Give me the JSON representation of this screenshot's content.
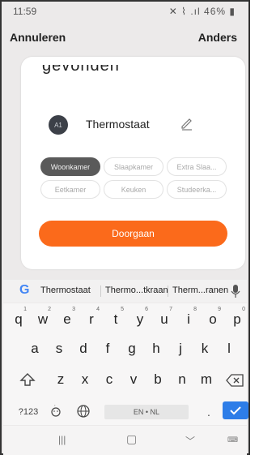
{
  "status_bar": {
    "time": "11:59",
    "indicators": "46%"
  },
  "nav": {
    "cancel_label": "Annuleren",
    "other_label": "Anders"
  },
  "card": {
    "heading_fragment": "gevonden",
    "device": {
      "avatar_text": "A1",
      "name": "Thermostaat"
    },
    "rooms": [
      {
        "label": "Woonkamer",
        "selected": true
      },
      {
        "label": "Slaapkamer",
        "selected": false
      },
      {
        "label": "Extra Slaa...",
        "selected": false
      },
      {
        "label": "Eetkamer",
        "selected": false
      },
      {
        "label": "Keuken",
        "selected": false
      },
      {
        "label": "Studeerka...",
        "selected": false
      }
    ],
    "continue_label": "Doorgaan"
  },
  "suggestions": [
    "Thermostaat",
    "Thermo...tkraan",
    "Therm...ranen"
  ],
  "keyboard": {
    "row1": [
      "q",
      "w",
      "e",
      "r",
      "t",
      "y",
      "u",
      "i",
      "o",
      "p"
    ],
    "row1_nums": [
      "1",
      "2",
      "3",
      "4",
      "5",
      "6",
      "7",
      "8",
      "9",
      "0"
    ],
    "row2": [
      "a",
      "s",
      "d",
      "f",
      "g",
      "h",
      "j",
      "k",
      "l"
    ],
    "row3": [
      "z",
      "x",
      "c",
      "v",
      "b",
      "n",
      "m"
    ],
    "symbols_key": "?123",
    "space_label": "EN • NL",
    "period_key": "."
  },
  "colors": {
    "accent": "#fb6a1b",
    "chip_selected": "#5a5a5a",
    "enter_key": "#2d7de8"
  }
}
